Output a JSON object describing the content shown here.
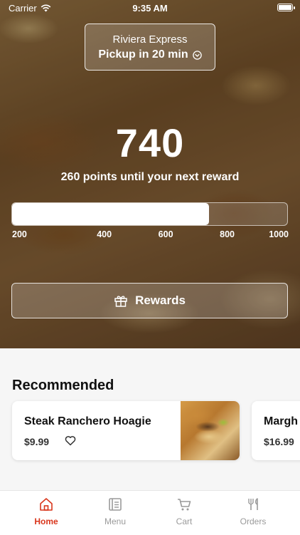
{
  "status_bar": {
    "carrier": "Carrier",
    "time": "9:35 AM"
  },
  "store": {
    "name": "Riviera Express",
    "pickup": "Pickup in 20 min"
  },
  "loyalty": {
    "points": "740",
    "until_text": "260 points until your next reward",
    "progress_value": 740,
    "progress_min": 100,
    "progress_max": 1000,
    "ticks": [
      "200",
      "400",
      "600",
      "800",
      "1000"
    ]
  },
  "rewards_button": {
    "label": "Rewards"
  },
  "recommended": {
    "title": "Recommended",
    "items": [
      {
        "name": "Steak Ranchero Hoagie",
        "price": "$9.99"
      },
      {
        "name": "Margh",
        "price": "$16.99"
      }
    ]
  },
  "tabs": [
    {
      "label": "Home",
      "icon": "home-icon",
      "active": true
    },
    {
      "label": "Menu",
      "icon": "menu-icon",
      "active": false
    },
    {
      "label": "Cart",
      "icon": "cart-icon",
      "active": false
    },
    {
      "label": "Orders",
      "icon": "orders-icon",
      "active": false
    }
  ],
  "colors": {
    "accent": "#d9361c",
    "inactive_tab": "#9a9a9a"
  }
}
